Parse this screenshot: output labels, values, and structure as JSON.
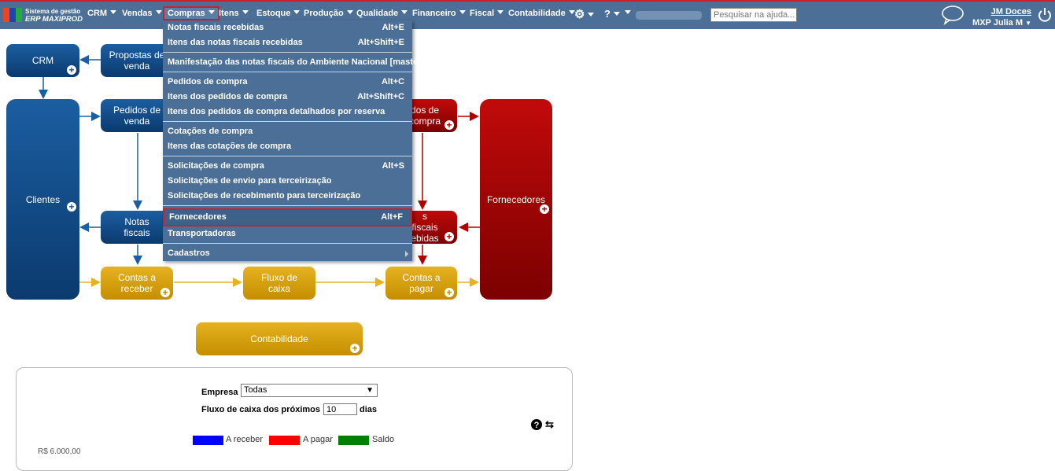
{
  "brand": {
    "line1": "Sistema de gestão",
    "line2": "ERP MAXIPROD"
  },
  "nav": {
    "items": [
      "CRM",
      "Vendas",
      "Compras",
      "Itens",
      "Estoque",
      "Produção",
      "Qualidade",
      "Financeiro",
      "Fiscal",
      "Contabilidade"
    ],
    "active": "Compras"
  },
  "search": {
    "placeholder": "Pesquisar na ajuda..."
  },
  "user": {
    "company": "JM Doces",
    "name": "MXP Julia M"
  },
  "dropdown": {
    "groups": [
      [
        {
          "label": "Notas fiscais recebidas",
          "shortcut": "Alt+E"
        },
        {
          "label": "Itens das notas fiscais recebidas",
          "shortcut": "Alt+Shift+E"
        }
      ],
      [
        {
          "label": "Manifestação das notas fiscais do Ambiente Nacional [master]",
          "shortcut": ""
        }
      ],
      [
        {
          "label": "Pedidos de compra",
          "shortcut": "Alt+C"
        },
        {
          "label": "Itens dos pedidos de compra",
          "shortcut": "Alt+Shift+C"
        },
        {
          "label": "Itens dos pedidos de compra detalhados por reserva",
          "shortcut": ""
        }
      ],
      [
        {
          "label": "Cotações de compra",
          "shortcut": ""
        },
        {
          "label": "Itens das cotações de compra",
          "shortcut": ""
        }
      ],
      [
        {
          "label": "Solicitações de compra",
          "shortcut": "Alt+S"
        },
        {
          "label": "Solicitações de envio para terceirização",
          "shortcut": ""
        },
        {
          "label": "Solicitações de recebimento para terceirização",
          "shortcut": ""
        }
      ],
      [
        {
          "label": "Fornecedores",
          "shortcut": "Alt+F",
          "highlight": true
        },
        {
          "label": "Transportadoras",
          "shortcut": ""
        }
      ],
      [
        {
          "label": "Cadastros",
          "shortcut": "",
          "submenu": true
        }
      ]
    ]
  },
  "diagram": {
    "crm": "CRM",
    "propostas": "Propostas de venda",
    "pedidos_venda": "Pedidos de venda",
    "clientes": "Clientes",
    "notas_fiscais": "Notas fiscais",
    "pedidos_compra": "dos de compra",
    "notas_recebidas": "s fiscais ebidas",
    "fornecedores": "Fornecedores",
    "contas_receber": "Contas a receber",
    "fluxo_caixa": "Fluxo de caixa",
    "contas_pagar": "Contas a pagar",
    "contabilidade": "Contabilidade"
  },
  "panel": {
    "empresa_label": "Empresa",
    "empresa_value": "Todas",
    "fluxo_label": "Fluxo de caixa dos próximos",
    "fluxo_days": "10",
    "dias_label": "dias",
    "legend": [
      {
        "label": "A receber",
        "color": "#0000ff"
      },
      {
        "label": "A pagar",
        "color": "#ff0000"
      },
      {
        "label": "Saldo",
        "color": "#008000"
      }
    ],
    "axis_first": "R$ 6.000,00"
  }
}
